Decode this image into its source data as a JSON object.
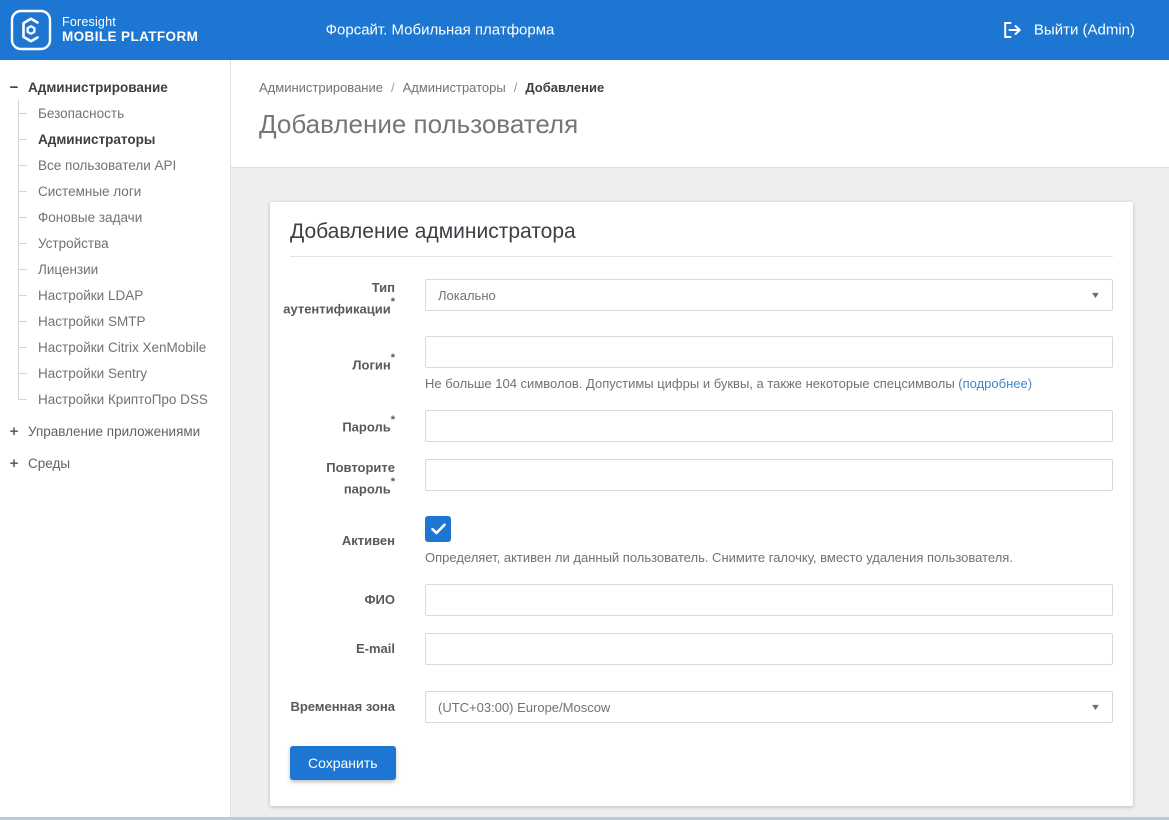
{
  "brand": {
    "name_top": "Foresight",
    "name_bottom": "MOBILE PLATFORM"
  },
  "header": {
    "app_title": "Форсайт. Мобильная платформа",
    "logout_label": "Выйти (Admin)"
  },
  "sidebar": {
    "sections": [
      {
        "label": "Администрирование",
        "toggle": "−",
        "state": "expanded",
        "items": [
          {
            "label": "Безопасность"
          },
          {
            "label": "Администраторы",
            "active": true
          },
          {
            "label": "Все пользователи API"
          },
          {
            "label": "Системные логи"
          },
          {
            "label": "Фоновые задачи"
          },
          {
            "label": "Устройства"
          },
          {
            "label": "Лицензии"
          },
          {
            "label": "Настройки LDAP"
          },
          {
            "label": "Настройки SMTP"
          },
          {
            "label": "Настройки Citrix XenMobile"
          },
          {
            "label": "Настройки Sentry"
          },
          {
            "label": "Настройки КриптоПро DSS"
          }
        ]
      },
      {
        "label": "Управление приложениями",
        "toggle": "+",
        "state": "collapsed",
        "items": []
      },
      {
        "label": "Среды",
        "toggle": "+",
        "state": "collapsed",
        "items": []
      }
    ]
  },
  "breadcrumb": {
    "separator": "/",
    "items": [
      "Администрирование",
      "Администраторы",
      "Добавление"
    ]
  },
  "page": {
    "title": "Добавление пользователя"
  },
  "form": {
    "title": "Добавление администратора",
    "fields": {
      "auth_type": {
        "label": "Тип аутентификации",
        "required": "*",
        "value": "Локально"
      },
      "login": {
        "label": "Логин",
        "required": "*",
        "value": "",
        "help_text": "Не больше 104 символов. Допустимы цифры и буквы, а также некоторые спецсимволы ",
        "help_link": "(подробнее)"
      },
      "password": {
        "label": "Пароль",
        "required": "*",
        "value": ""
      },
      "password_repeat": {
        "label": "Повторите пароль",
        "required": "*",
        "value": ""
      },
      "active": {
        "label": "Активен",
        "checked": true,
        "help_text": "Определяет, активен ли данный пользователь. Снимите галочку, вместо удаления пользователя."
      },
      "full_name": {
        "label": "ФИО",
        "value": ""
      },
      "email": {
        "label": "E-mail",
        "value": ""
      },
      "timezone": {
        "label": "Временная зона",
        "value": "(UTC+03:00) Europe/Moscow"
      }
    },
    "save_label": "Сохранить"
  },
  "colors": {
    "accent": "#1d76d2",
    "link": "#4285c8",
    "header": "#1d76d2"
  }
}
